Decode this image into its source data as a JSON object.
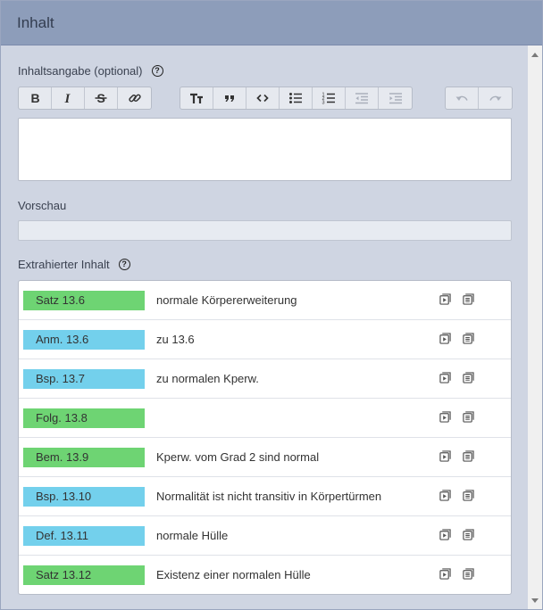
{
  "panel": {
    "title": "Inhalt"
  },
  "summary": {
    "label": "Inhaltsangabe (optional)",
    "value": ""
  },
  "toolbar": {
    "groups": [
      [
        "bold-icon",
        "italic-icon",
        "strikethrough-icon",
        "link-icon"
      ],
      [
        "heading-icon",
        "quote-icon",
        "code-icon",
        "bullet-list-icon",
        "numbered-list-icon",
        "outdent-icon",
        "indent-icon"
      ],
      [
        "undo-icon",
        "redo-icon"
      ]
    ]
  },
  "preview": {
    "label": "Vorschau",
    "value": ""
  },
  "extracted": {
    "label": "Extrahierter Inhalt",
    "colors": {
      "green": "#6ed473",
      "blue": "#73d0ec"
    },
    "items": [
      {
        "tag": "Satz 13.6",
        "color": "green",
        "text": "normale Körpererweiterung"
      },
      {
        "tag": "Anm. 13.6",
        "color": "blue",
        "text": "zu 13.6"
      },
      {
        "tag": "Bsp. 13.7",
        "color": "blue",
        "text": "zu normalen Kperw."
      },
      {
        "tag": "Folg. 13.8",
        "color": "green",
        "text": ""
      },
      {
        "tag": "Bem. 13.9",
        "color": "green",
        "text": "Kperw. vom Grad 2 sind normal"
      },
      {
        "tag": "Bsp. 13.10",
        "color": "blue",
        "text": "Normalität ist nicht transitiv in Körpertürmen"
      },
      {
        "tag": "Def. 13.11",
        "color": "blue",
        "text": "normale Hülle"
      },
      {
        "tag": "Satz 13.12",
        "color": "green",
        "text": "Existenz einer normalen Hülle"
      }
    ]
  }
}
